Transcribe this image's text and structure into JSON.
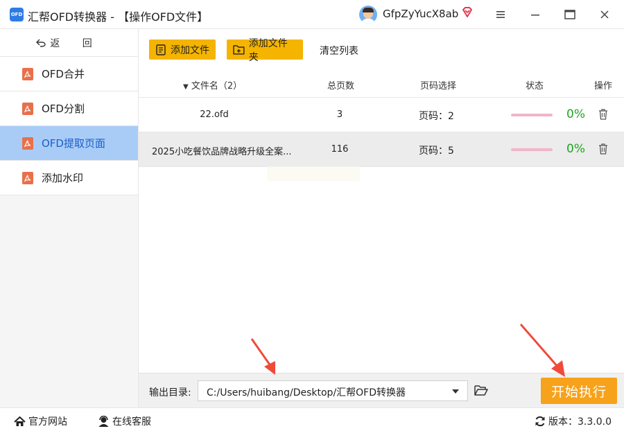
{
  "window": {
    "logo_text": "OFD",
    "title": "汇帮OFD转换器 - 【操作OFD文件】",
    "user_name": "GfpZyYucX8ab"
  },
  "sidebar": {
    "back_label": "返 回",
    "items": [
      {
        "label": "OFD合并",
        "active": false
      },
      {
        "label": "OFD分割",
        "active": false
      },
      {
        "label": "OFD提取页面",
        "active": true
      },
      {
        "label": "添加水印",
        "active": false
      }
    ]
  },
  "toolbar": {
    "add_file": "添加文件",
    "add_folder": "添加文件夹",
    "clear_list": "清空列表"
  },
  "table": {
    "headers": {
      "name": "文件名（2）",
      "pages": "总页数",
      "range": "页码选择",
      "status": "状态",
      "ops": "操作"
    },
    "rows": [
      {
        "name": "22.ofd",
        "pages": "3",
        "range": "页码：2",
        "progress": "0%"
      },
      {
        "name": "2025小吃餐饮品牌战略升级全案...",
        "pages": "116",
        "range": "页码：5",
        "progress": "0%"
      }
    ]
  },
  "output": {
    "label": "输出目录:",
    "path": "C:/Users/huibang/Desktop/汇帮OFD转换器",
    "start_button": "开始执行"
  },
  "statusbar": {
    "website": "官方网站",
    "service": "在线客服",
    "version": "版本：3.3.0.0"
  },
  "colors": {
    "accent_yellow": "#f5b400",
    "start_orange": "#f7a21b",
    "active_nav": "#a9ccf7",
    "progress_green": "#1ea51e",
    "pdf_icon_orange": "#e8704a",
    "arrow_red": "#f04a3a"
  }
}
